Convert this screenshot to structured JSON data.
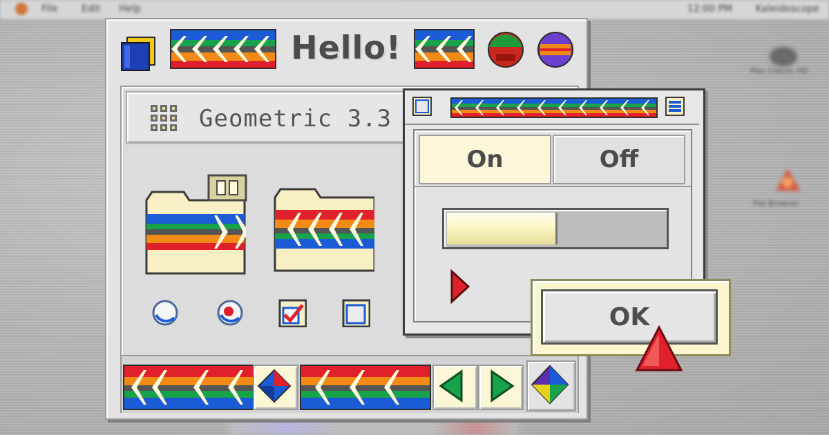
{
  "background": {
    "menubar": {
      "items": [
        "File",
        "Edit",
        "Help"
      ],
      "clock": "12:00 PM",
      "app": "Kaleidoscope"
    },
    "desktop_icons": [
      {
        "label": "Mac Classic HD"
      },
      {
        "label": "File Browser"
      }
    ]
  },
  "window": {
    "title": "Hello!",
    "tab": {
      "label": "Geometric 3.3"
    },
    "controls": {
      "radio_off": "radio-unselected",
      "radio_on": "radio-selected",
      "checkbox_checked": true,
      "checkbox_unchecked": false
    }
  },
  "palette": {
    "segmented": {
      "on": "On",
      "off": "Off",
      "selected": "On"
    },
    "progress": 0.5
  },
  "ok_button": {
    "label": "OK"
  },
  "colors": {
    "accent": "#e0202a",
    "window_bg": "#e3e3e3",
    "highlight": "#fbf6d6"
  }
}
